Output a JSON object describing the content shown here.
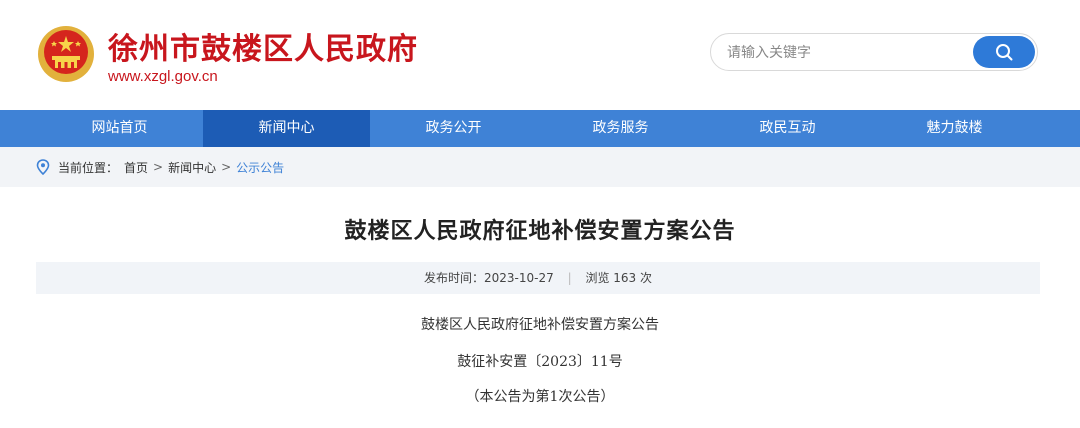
{
  "header": {
    "site_title": "徐州市鼓楼区人民政府",
    "site_url": "www.xzgl.gov.cn",
    "emblem_icon": "national-emblem-icon"
  },
  "search": {
    "placeholder": "请输入关键字",
    "button_icon": "search-icon"
  },
  "nav": {
    "items": [
      {
        "label": "网站首页"
      },
      {
        "label": "新闻中心"
      },
      {
        "label": "政务公开"
      },
      {
        "label": "政务服务"
      },
      {
        "label": "政民互动"
      },
      {
        "label": "魅力鼓楼"
      }
    ],
    "active_index": 1
  },
  "breadcrumb": {
    "prefix": "当前位置：",
    "items": [
      "首页",
      "新闻中心",
      "公示公告"
    ],
    "separator": ">"
  },
  "article": {
    "title": "鼓楼区人民政府征地补偿安置方案公告",
    "meta_date": "发布时间：2023-10-27",
    "meta_views": "浏览 163 次",
    "lines": [
      "鼓楼区人民政府征地补偿安置方案公告",
      "鼓征补安置〔2023〕11号",
      "（本公告为第1次公告）"
    ]
  },
  "colors": {
    "brand_red": "#c8161d",
    "nav_blue": "#3f82d6",
    "nav_active": "#1d5cb5"
  }
}
